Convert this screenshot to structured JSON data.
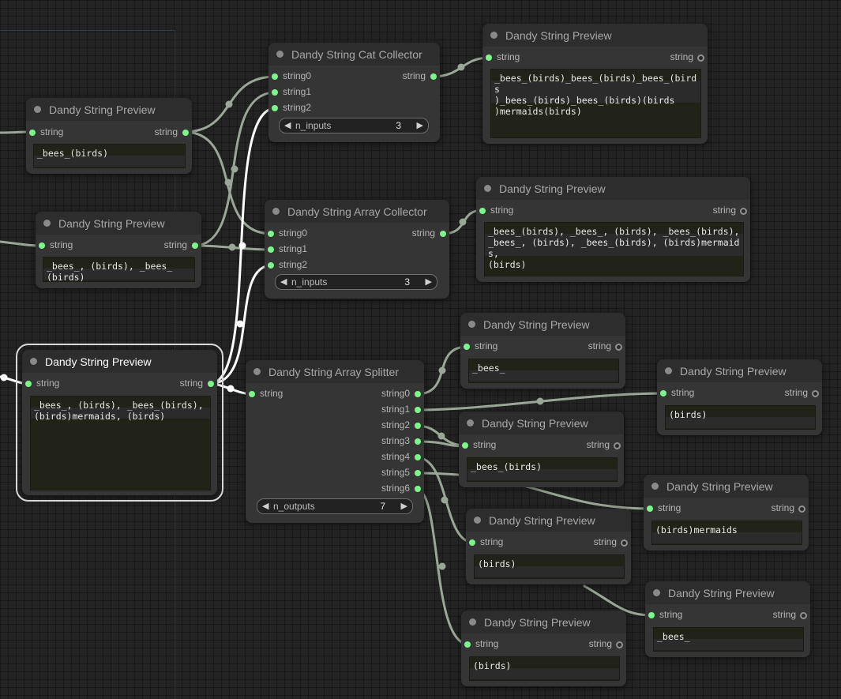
{
  "colors": {
    "background": "#232323",
    "node_body": "#353535",
    "node_title_bar": "#2d2d2d",
    "link": "#9aa697",
    "link_selected": "#ffffff",
    "slot_connected": "#7cf58a"
  },
  "nodes": [
    {
      "id": "preview_a",
      "title": "Dandy String Preview",
      "input_label": "string",
      "output_label": "string",
      "text": "_bees_(birds)"
    },
    {
      "id": "preview_b",
      "title": "Dandy String Preview",
      "input_label": "string",
      "output_label": "string",
      "text": "_bees_, (birds), _bees_\n(birds)"
    },
    {
      "id": "preview_main",
      "title": "Dandy String Preview",
      "input_label": "string",
      "output_label": "string",
      "text": "_bees_, (birds), _bees_(birds),\n(birds)mermaids, (birds)"
    },
    {
      "id": "cat_collector",
      "title": "Dandy String Cat Collector",
      "inputs": [
        "string0",
        "string1",
        "string2"
      ],
      "output_label": "string",
      "widget": {
        "name": "n_inputs",
        "value": "3"
      }
    },
    {
      "id": "array_collector",
      "title": "Dandy String Array Collector",
      "inputs": [
        "string0",
        "string1",
        "string2"
      ],
      "output_label": "string",
      "widget": {
        "name": "n_inputs",
        "value": "3"
      }
    },
    {
      "id": "array_splitter",
      "title": "Dandy String Array Splitter",
      "inputs": [
        "string"
      ],
      "outputs": [
        "string0",
        "string1",
        "string2",
        "string3",
        "string4",
        "string5",
        "string6"
      ],
      "widget": {
        "name": "n_outputs",
        "value": "7"
      }
    },
    {
      "id": "preview_cat",
      "title": "Dandy String Preview",
      "input_label": "string",
      "output_label": "string",
      "text": "_bees_(birds)_bees_(birds)_bees_(birds\n)_bees_(birds)_bees_(birds)(birds\n)mermaids(birds)"
    },
    {
      "id": "preview_arr",
      "title": "Dandy String Preview",
      "input_label": "string",
      "output_label": "string",
      "text": "_bees_(birds), _bees_, (birds), _bees_(birds),\n_bees_, (birds), _bees_(birds), (birds)mermaids,\n(birds)"
    },
    {
      "id": "preview_s0",
      "title": "Dandy String Preview",
      "input_label": "string",
      "output_label": "string",
      "text": "_bees_"
    },
    {
      "id": "preview_s1",
      "title": "Dandy String Preview",
      "input_label": "string",
      "output_label": "string",
      "text": "(birds)"
    },
    {
      "id": "preview_s2",
      "title": "Dandy String Preview",
      "input_label": "string",
      "output_label": "string",
      "text": "_bees_(birds)"
    },
    {
      "id": "preview_s3",
      "title": "Dandy String Preview",
      "input_label": "string",
      "output_label": "string",
      "text": "(birds)mermaids"
    },
    {
      "id": "preview_s4",
      "title": "Dandy String Preview",
      "input_label": "string",
      "output_label": "string",
      "text": "(birds)"
    },
    {
      "id": "preview_s5",
      "title": "Dandy String Preview",
      "input_label": "string",
      "output_label": "string",
      "text": "_bees_"
    },
    {
      "id": "preview_s6",
      "title": "Dandy String Preview",
      "input_label": "string",
      "output_label": "string",
      "text": "(birds)"
    }
  ]
}
